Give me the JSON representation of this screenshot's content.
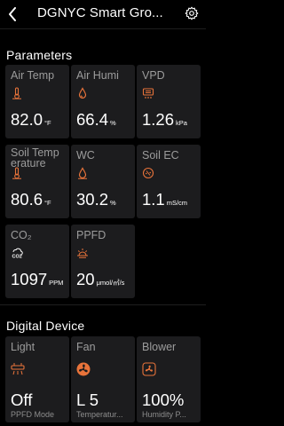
{
  "header": {
    "title": "DGNYC Smart Gro...",
    "back_icon": "chevron-left-icon",
    "settings_icon": "gear-icon"
  },
  "parameters": {
    "title": "Parameters",
    "cards": [
      {
        "label": "Air Temp",
        "value": "82.0",
        "unit": "°F",
        "icon": "thermometer-icon"
      },
      {
        "label": "Air Humi",
        "value": "66.4",
        "unit": "%",
        "icon": "droplet-icon"
      },
      {
        "label": "VPD",
        "value": "1.26",
        "unit": "kPa",
        "icon": "vpd-icon"
      },
      {
        "label": "Soil Temp erature",
        "value": "80.6",
        "unit": "°F",
        "icon": "thermometer-icon"
      },
      {
        "label": "WC",
        "value": "30.2",
        "unit": "%",
        "icon": "droplet-icon"
      },
      {
        "label": "Soil EC",
        "value": "1.1",
        "unit": "mS/cm",
        "icon": "ec-icon"
      },
      {
        "label": "CO₂",
        "value": "1097",
        "unit": "PPM",
        "icon": "co2-icon"
      },
      {
        "label": "PPFD",
        "value": "20",
        "unit": "μmol/㎡/s",
        "icon": "sun-icon"
      }
    ]
  },
  "digital_device": {
    "title": "Digital Device",
    "cards": [
      {
        "label": "Light",
        "value": "Off",
        "sub": "PPFD Mode",
        "icon": "grow-light-icon"
      },
      {
        "label": "Fan",
        "value": "L 5",
        "sub": "Temperatur...",
        "icon": "fan-icon"
      },
      {
        "label": "Blower",
        "value": "100%",
        "sub": "Humidity P...",
        "icon": "blower-icon"
      }
    ]
  },
  "colors": {
    "background": "#000000",
    "card": "#1c1c1e",
    "accent": "#e8733a",
    "label": "#9c9c9c"
  }
}
